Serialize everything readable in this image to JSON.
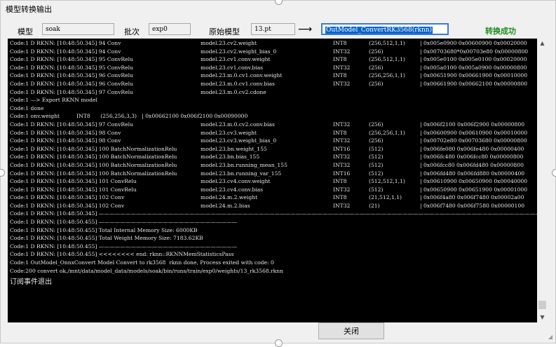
{
  "window": {
    "title": "模型转换输出"
  },
  "form": {
    "model_label": "模型",
    "model_value": "soak",
    "batch_label": "批次",
    "batch_value": "exp0",
    "source_label": "原始模型",
    "source_value": "13.pt",
    "arrow": "⟶",
    "output_value": "OutModel_ConvertRK3568(rknn)",
    "status": "转换成功"
  },
  "log_lines": [
    [
      "Code:1 D RKNN: [10:48:50.345] 94 Conv",
      "model.23.cv2.weight",
      "INT8",
      "(256,512,1,1)",
      "| 0x005e0900 0x00600900 0x00020000"
    ],
    [
      "Code:1 D RKNN: [10:48:50.345] 94 Conv",
      "model.23.cv2.weight_bias_0",
      "INT32",
      "(256)",
      "| 0x00703680*0x00703e80 0x00000800"
    ],
    [
      "Code:1 D RKNN: [10:48:50.345] 95 ConvRelu",
      "model.23.cv1.conv.weight",
      "INT8",
      "(256,512,1,1)",
      "| 0x005e0100 0x005e0100 0x00020000"
    ],
    [
      "Code:1 D RKNN: [10:48:50.345] 95 ConvRelu",
      "model.23.cv1.conv.bias",
      "INT32",
      "(256)",
      "| 0x005a0100 0x005a0900 0x00000800"
    ],
    [
      "Code:1 D RKNN: [10:48:50.345] 96 ConvRelu",
      "model.23.m.0.cv1.conv.weight",
      "INT8",
      "(256,256,1,1)",
      "| 0x00651900 0x00661900 0x00010000"
    ],
    [
      "Code:1 D RKNN: [10:48:50.345] 96 ConvRelu",
      "model.23.m.0.cv1.conv.bias",
      "INT32",
      "(256)",
      "| 0x00661900 0x00662100 0x00000800"
    ],
    [
      "Code:1 D RKNN: [10:48:50.345] 97 ConvRelu",
      "model.23.m.0.cv2.cdone",
      "",
      "",
      ""
    ],
    [
      "Code:1 —> Export RKNN model",
      "",
      "",
      "",
      ""
    ],
    [
      "Code:1 done",
      "",
      "",
      "",
      ""
    ],
    [
      "Code:1 onv.weight          INT8      (256,256,3,3)   | 0x00662100 0x006f2100 0x00090000",
      "",
      "",
      "",
      ""
    ],
    [
      "Code:1 D RKNN: [10:48:50.345] 97 ConvRelu",
      "model.23.m.0.cv2.conv.bias",
      "INT32",
      "(256)",
      "| 0x006f2100 0x006f2900 0x00000800"
    ],
    [
      "Code:1 D RKNN: [10:48:50.345] 98 Conv",
      "model.23.cv3.weight",
      "INT8",
      "(256,256,1,1)",
      "| 0x00600900 0x00610900 0x00010000"
    ],
    [
      "Code:1 D RKNN: [10:48:50.345] 98 Conv",
      "model.23.cv3.weight_bias_0",
      "INT32",
      "(256)",
      "| 0x00702e80 0x00703680 0x00000800"
    ],
    [
      "Code:1 D RKNN: [10:48:50.345] 100 BatchNormalizationRelu",
      "model.23.bn.weight_155",
      "INT16",
      "(512)",
      "| 0x006fe080 0x006fe480 0x00000400"
    ],
    [
      "Code:1 D RKNN: [10:48:50.345] 100 BatchNormalizationRelu",
      "model.23.bn.bias_155",
      "INT32",
      "(512)",
      "| 0x006fc480 0x006fcc80 0x00000800"
    ],
    [
      "Code:1 D RKNN: [10:48:50.345] 100 BatchNormalizationRelu",
      "model.23.bn.running_mean_155",
      "INT32",
      "(512)",
      "| 0x006fcc80 0x006fd480 0x00000800"
    ],
    [
      "Code:1 D RKNN: [10:48:50.345] 100 BatchNormalizationRelu",
      "model.23.bn.running_var_155",
      "INT16",
      "(512)",
      "| 0x006fd480 0x006fd880 0x00000400"
    ],
    [
      "Code:1 D RKNN: [10:48:50.345] 101 ConvRelu",
      "model.23.cv4.conv.weight",
      "INT8",
      "(512,512,1,1)",
      "| 0x00610900 0x00650900 0x00040000"
    ],
    [
      "Code:1 D RKNN: [10:48:50.345] 101 ConvRelu",
      "model.23.cv4.conv.bias",
      "INT32",
      "(512)",
      "| 0x00650900 0x00651900 0x00001000"
    ],
    [
      "Code:1 D RKNN: [10:48:50.345] 102 Conv",
      "model.24.m.2.weight",
      "INT8",
      "(21,512,1,1)",
      "| 0x006f4a80 0x006f7480 0x00002a00"
    ],
    [
      "Code:1 D RKNN: [10:48:50.345] 102 Conv",
      "model.24.m.2.bias",
      "INT32",
      "(21)",
      "| 0x006f7480 0x006f7580 0x00000100"
    ],
    [
      "Code:1 D RKNN: [10:48:50.345] ————————————————————————————————————————————————————————————————————————————————————————————",
      "",
      "",
      "",
      ""
    ],
    [
      "Code:1 D RKNN: [10:48:50.455] ——————————————————————————",
      "",
      "",
      "",
      ""
    ],
    [
      "Code:1 D RKNN: [10:48:50.455] Total Internal Memory Size: 6000KB",
      "",
      "",
      "",
      ""
    ],
    [
      "Code:1 D RKNN: [10:48:50.455] Total Weight Memory Size: 7183.62KB",
      "",
      "",
      "",
      ""
    ],
    [
      "Code:1 D RKNN: [10:48:50.455] ——————————————————————————",
      "",
      "",
      "",
      ""
    ],
    [
      "Code:1 D RKNN: [10:48:50.455] <<<<<<<< end: rknn::RKNNMemStatisticsPass",
      "",
      "",
      "",
      ""
    ],
    [
      "Code:1 OutModel_OnnxConvert Model Convert to rk3568  rknn done, Process exited with code: 0",
      "",
      "",
      "",
      ""
    ],
    [
      "Code:200 convert ok,/mnt/data/model_data/models/soak/bin/runs/train/exp0/weights/13_rk3568.rknn",
      "",
      "",
      "",
      ""
    ]
  ],
  "log_footer": "订阅事件退出",
  "close_button": "关闭",
  "icons": {
    "scroll_up": "scroll-up-icon",
    "scroll_down": "scroll-down-icon",
    "resize": "resize-grip-icon"
  }
}
